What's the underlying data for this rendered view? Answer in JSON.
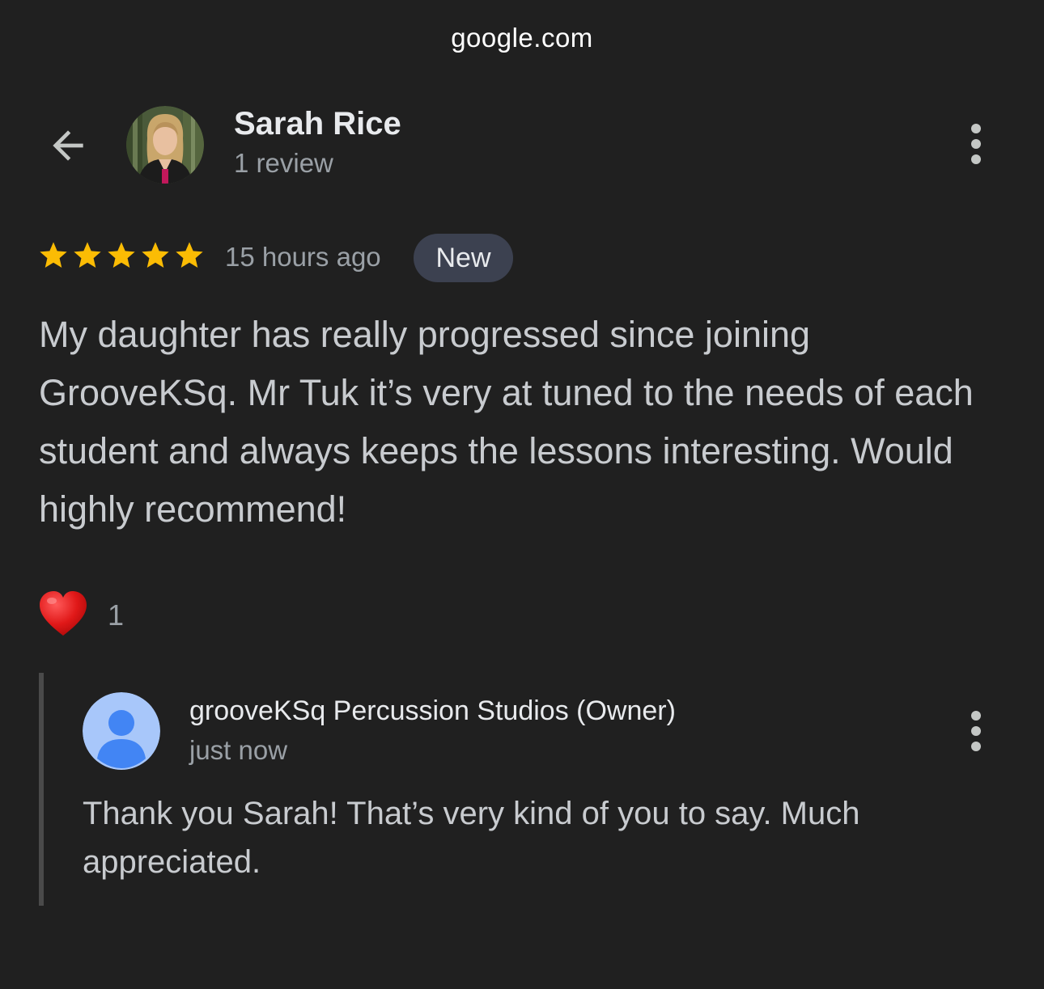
{
  "browser": {
    "url": "google.com"
  },
  "reviewer": {
    "name": "Sarah Rice",
    "review_count": "1 review",
    "avatar_icon": "profile-photo"
  },
  "review": {
    "rating": 5,
    "max_rating": 5,
    "star_color": "#fbbc04",
    "time_ago": "15 hours ago",
    "badge": "New",
    "text": "My daughter has really progressed since joining GrooveKSq. Mr Tuk it’s very at tuned to the needs of each student and always keeps the lessons interesting. Would highly recommend!"
  },
  "reactions": {
    "icon": "heart-icon",
    "count": "1"
  },
  "owner_reply": {
    "name": "grooveKSq Percussion Studios (Owner)",
    "time": "just now",
    "text": "Thank you Sarah! That’s very kind of you to say. Much appreciated.",
    "avatar_icon": "default-person-avatar"
  },
  "icons": {
    "back": "back-arrow-icon",
    "more": "more-vert-icon"
  }
}
